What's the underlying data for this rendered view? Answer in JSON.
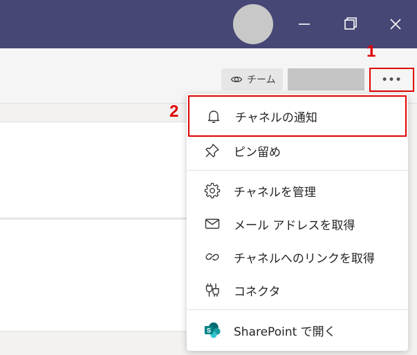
{
  "titlebar": {
    "avatar_icon": "avatar",
    "minimize_icon": "minimize-icon",
    "restore_icon": "restore-icon",
    "close_icon": "close-icon"
  },
  "header": {
    "team_button_label": "チーム",
    "more_button_label": "•••"
  },
  "annotations": {
    "step_1": "1",
    "step_2": "2"
  },
  "menu": {
    "items": [
      {
        "label": "チャネルの通知",
        "icon": "bell-icon"
      },
      {
        "label": "ピン留め",
        "icon": "pin-icon"
      },
      {
        "label": "チャネルを管理",
        "icon": "gear-icon"
      },
      {
        "label": "メール アドレスを取得",
        "icon": "mail-icon"
      },
      {
        "label": "チャネルへのリンクを取得",
        "icon": "link-icon"
      },
      {
        "label": "コネクタ",
        "icon": "connector-icon"
      },
      {
        "label": "SharePoint で開く",
        "icon": "sharepoint-icon"
      }
    ]
  },
  "colors": {
    "titlebar": "#464775",
    "highlight": "#e00000",
    "sharepoint": "#038387"
  }
}
